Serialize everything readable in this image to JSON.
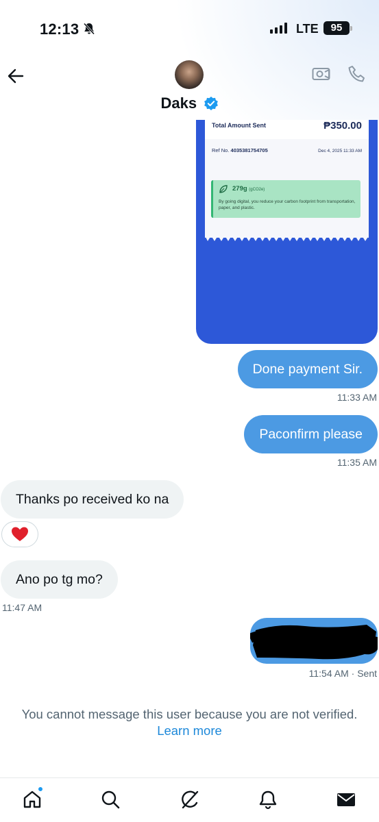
{
  "status_bar": {
    "time": "12:13",
    "network": "LTE",
    "battery": "95",
    "icons": [
      "bell-slash-icon",
      "signal-bars-icon",
      "battery-icon"
    ]
  },
  "header": {
    "contact_name": "Daks",
    "icons": [
      "back-arrow-icon",
      "verified-badge-icon",
      "video-camera-icon",
      "phone-icon"
    ]
  },
  "receipt": {
    "total_label": "Total Amount Sent",
    "total_value": "₱350.00",
    "ref_label": "Ref No.",
    "ref_number": "4035381754705",
    "date": "Dec 4, 2025 11:33 AM",
    "eco_amount": "279g",
    "eco_unit": "(gCO2e)",
    "eco_text": "By going digital, you reduce your carbon footprint from transportation, paper, and plastic."
  },
  "messages": [
    {
      "direction": "out",
      "text": "Done payment Sir.",
      "time": "11:33 AM"
    },
    {
      "direction": "out",
      "text": "Paconfirm please",
      "time": "11:35 AM"
    },
    {
      "direction": "in",
      "text": "Thanks po received ko na",
      "reaction": "❤️"
    },
    {
      "direction": "in",
      "text": "Ano po tg mo?",
      "time": "11:47 AM"
    },
    {
      "direction": "out",
      "text": "",
      "time": "11:54 AM",
      "status": "· Sent"
    }
  ],
  "notice": {
    "text": "You cannot message this user because you are not verified.",
    "link": "Learn more"
  },
  "bottom_nav": {
    "items": [
      "home-icon",
      "search-icon",
      "grok-icon",
      "notifications-bell-icon",
      "messages-envelope-icon"
    ],
    "colors": {
      "accent": "#1d9bf0",
      "bubble_out": "#4c9ae3",
      "bubble_in": "#eff3f4",
      "receipt_blue": "#2d58d8"
    }
  }
}
